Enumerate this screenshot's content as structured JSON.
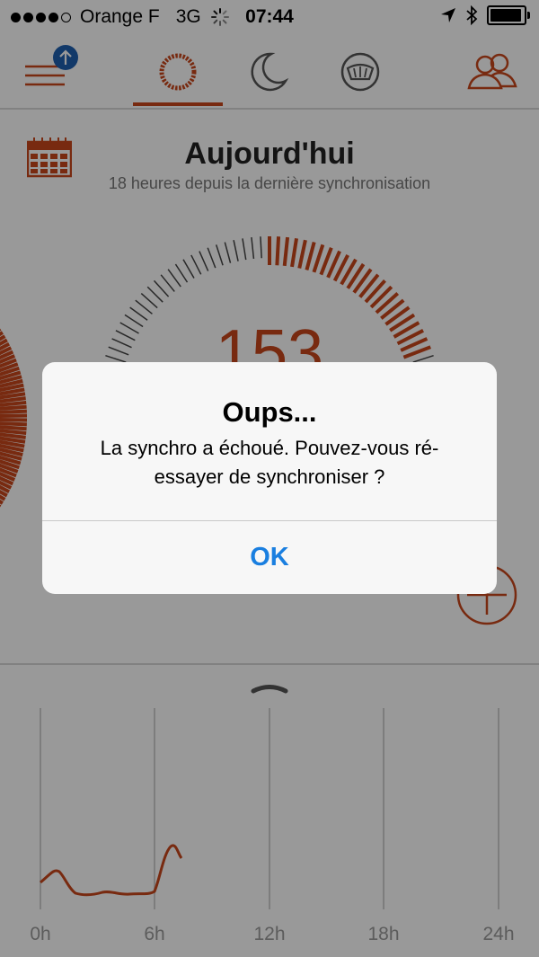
{
  "status_bar": {
    "carrier": "Orange F",
    "network": "3G",
    "time": "07:44",
    "signal_bars_filled": 4,
    "signal_bars_total": 5,
    "icons": [
      "activity-spinner-icon",
      "location-arrow-icon",
      "bluetooth-icon",
      "battery-icon"
    ]
  },
  "nav": {
    "icons": [
      "menu-icon",
      "sync-upload-badge-icon",
      "activity-ring-icon",
      "moon-sleep-icon",
      "food-bowl-icon",
      "friends-icon"
    ],
    "active_tab": "activity-ring-icon",
    "accent_color": "#c8461b"
  },
  "header": {
    "title": "Aujourd'hui",
    "subtitle": "18 heures depuis la dernière synchronisation",
    "calendar_icon": "calendar-icon"
  },
  "gauge": {
    "value": "153",
    "progress_fraction": 0.2
  },
  "timeline": {
    "x_labels": [
      "0h",
      "6h",
      "12h",
      "18h",
      "24h"
    ]
  },
  "alert": {
    "title": "Oups...",
    "message": "La synchro a échoué. Pouvez-vous ré-essayer de synchroniser ?",
    "ok_label": "OK",
    "ok_color": "#1a7fe0"
  }
}
